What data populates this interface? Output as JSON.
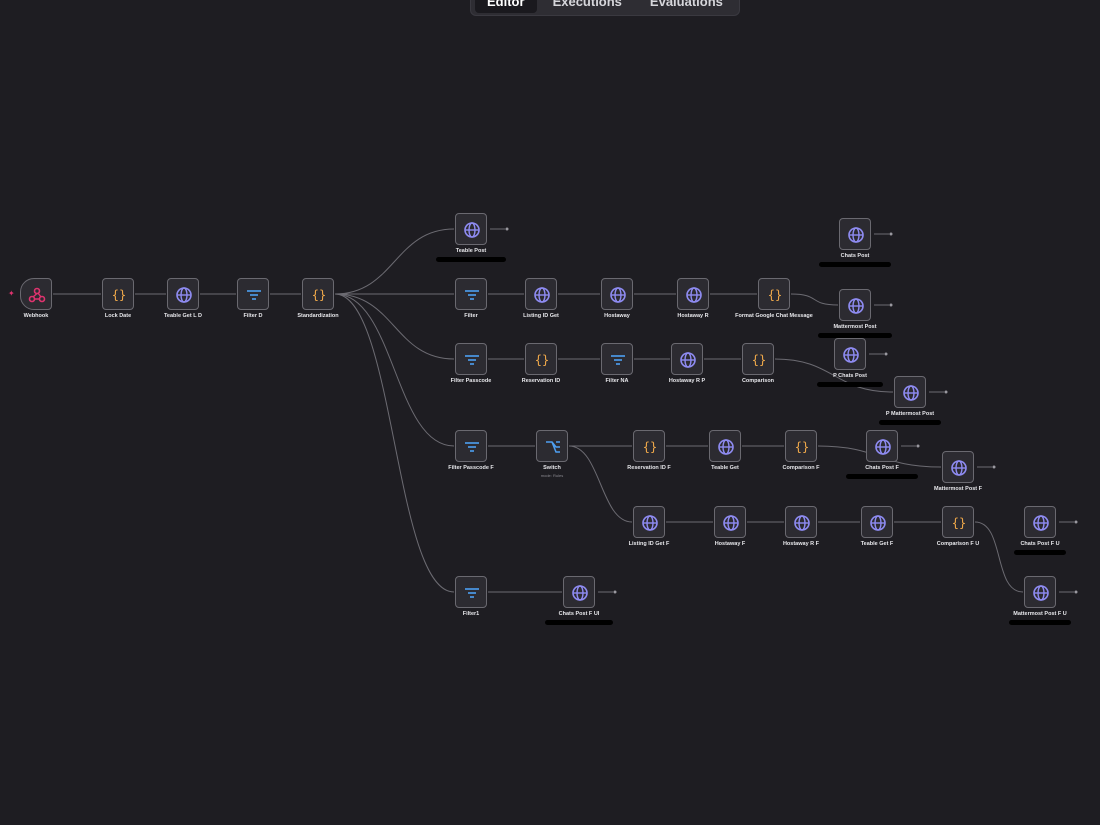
{
  "tabs": [
    {
      "label": "Editor",
      "active": true
    },
    {
      "label": "Executions",
      "active": false
    },
    {
      "label": "Evaluations",
      "active": false
    }
  ],
  "colors": {
    "background": "#1e1d22",
    "node_bg": "#2c2b31",
    "node_border": "#6a6970",
    "edge": "#6c6b72",
    "http_icon": "#8f8cf3",
    "code_icon": "#f0a94a",
    "filter_icon": "#4ea0f2",
    "webhook_icon": "#e0336f",
    "switch_icon": "#4ea0f2"
  },
  "nodes": [
    {
      "id": "webhook",
      "label": "Webhook",
      "icon": "webhook-icon"
    },
    {
      "id": "lock_date",
      "label": "Lock Date",
      "icon": "code-icon"
    },
    {
      "id": "teable_get_ld",
      "label": "Teable Get L D",
      "icon": "globe-icon"
    },
    {
      "id": "filter_d",
      "label": "Filter D",
      "icon": "filter-icon"
    },
    {
      "id": "standardization",
      "label": "Standardization",
      "icon": "code-icon"
    },
    {
      "id": "teable_post",
      "label": "Teable Post",
      "icon": "globe-icon"
    },
    {
      "id": "filter",
      "label": "Filter",
      "icon": "filter-icon"
    },
    {
      "id": "listing_id_get",
      "label": "Listing ID Get",
      "icon": "globe-icon"
    },
    {
      "id": "hostaway",
      "label": "Hostaway",
      "icon": "globe-icon"
    },
    {
      "id": "hostaway_r",
      "label": "Hostaway R",
      "icon": "globe-icon"
    },
    {
      "id": "format_gchat",
      "label": "Format Google Chat Message",
      "icon": "code-icon"
    },
    {
      "id": "chats_post",
      "label": "Chats Post",
      "icon": "globe-icon"
    },
    {
      "id": "mattermost_post",
      "label": "Mattermost Post",
      "icon": "globe-icon"
    },
    {
      "id": "filter_passcode",
      "label": "Filter Passcode",
      "icon": "filter-icon"
    },
    {
      "id": "reservation_id",
      "label": "Reservation ID",
      "icon": "code-icon"
    },
    {
      "id": "filter_na",
      "label": "Filter NA",
      "icon": "filter-icon"
    },
    {
      "id": "hostaway_rp",
      "label": "Hostaway R P",
      "icon": "globe-icon"
    },
    {
      "id": "comparison",
      "label": "Comparison",
      "icon": "code-icon"
    },
    {
      "id": "p_chats_post",
      "label": "P Chats Post",
      "icon": "globe-icon"
    },
    {
      "id": "p_mattermost_post",
      "label": "P Mattermost Post",
      "icon": "globe-icon"
    },
    {
      "id": "filter_passcode_f",
      "label": "Filter Passcode F",
      "icon": "filter-icon"
    },
    {
      "id": "switch",
      "label": "Switch",
      "sublabel": "mode: Rules",
      "icon": "switch-icon"
    },
    {
      "id": "reservation_id_f",
      "label": "Reservation ID F",
      "icon": "code-icon"
    },
    {
      "id": "teable_get",
      "label": "Teable Get",
      "icon": "globe-icon"
    },
    {
      "id": "comparison_f",
      "label": "Comparison F",
      "icon": "code-icon"
    },
    {
      "id": "chats_post_f",
      "label": "Chats Post F",
      "icon": "globe-icon"
    },
    {
      "id": "mattermost_post_f",
      "label": "Mattermost Post F",
      "icon": "globe-icon"
    },
    {
      "id": "listing_id_get_f",
      "label": "Listing ID Get F",
      "icon": "globe-icon"
    },
    {
      "id": "hostaway_f",
      "label": "Hostaway F",
      "icon": "globe-icon"
    },
    {
      "id": "hostaway_rf",
      "label": "Hostaway R F",
      "icon": "globe-icon"
    },
    {
      "id": "teable_get_f",
      "label": "Teable Get F",
      "icon": "globe-icon"
    },
    {
      "id": "comparison_fu",
      "label": "Comparison F U",
      "icon": "code-icon"
    },
    {
      "id": "chats_post_fu",
      "label": "Chats Post F U",
      "icon": "globe-icon"
    },
    {
      "id": "mattermost_post_fu",
      "label": "Mattermost Post F U",
      "icon": "globe-icon"
    },
    {
      "id": "filter1",
      "label": "Filter1",
      "icon": "filter-icon"
    },
    {
      "id": "chats_post_fui",
      "label": "Chats Post F UI",
      "icon": "globe-icon"
    }
  ],
  "connections": [
    [
      "webhook",
      "lock_date"
    ],
    [
      "lock_date",
      "teable_get_ld"
    ],
    [
      "teable_get_ld",
      "filter_d"
    ],
    [
      "filter_d",
      "standardization"
    ],
    [
      "standardization",
      "teable_post"
    ],
    [
      "standardization",
      "filter"
    ],
    [
      "standardization",
      "filter_passcode"
    ],
    [
      "standardization",
      "filter_passcode_f"
    ],
    [
      "standardization",
      "filter1"
    ],
    [
      "filter",
      "listing_id_get"
    ],
    [
      "listing_id_get",
      "hostaway"
    ],
    [
      "hostaway",
      "hostaway_r"
    ],
    [
      "hostaway_r",
      "format_gchat"
    ],
    [
      "format_gchat",
      "mattermost_post"
    ],
    [
      "filter_passcode",
      "reservation_id"
    ],
    [
      "reservation_id",
      "filter_na"
    ],
    [
      "filter_na",
      "hostaway_rp"
    ],
    [
      "hostaway_rp",
      "comparison"
    ],
    [
      "comparison",
      "p_mattermost_post"
    ],
    [
      "filter_passcode_f",
      "switch"
    ],
    [
      "switch",
      "reservation_id_f"
    ],
    [
      "switch",
      "listing_id_get_f"
    ],
    [
      "reservation_id_f",
      "teable_get"
    ],
    [
      "teable_get",
      "comparison_f"
    ],
    [
      "comparison_f",
      "mattermost_post_f"
    ],
    [
      "listing_id_get_f",
      "hostaway_f"
    ],
    [
      "hostaway_f",
      "hostaway_rf"
    ],
    [
      "hostaway_rf",
      "teable_get_f"
    ],
    [
      "teable_get_f",
      "comparison_fu"
    ],
    [
      "comparison_fu",
      "mattermost_post_fu"
    ],
    [
      "filter1",
      "chats_post_fui"
    ]
  ]
}
